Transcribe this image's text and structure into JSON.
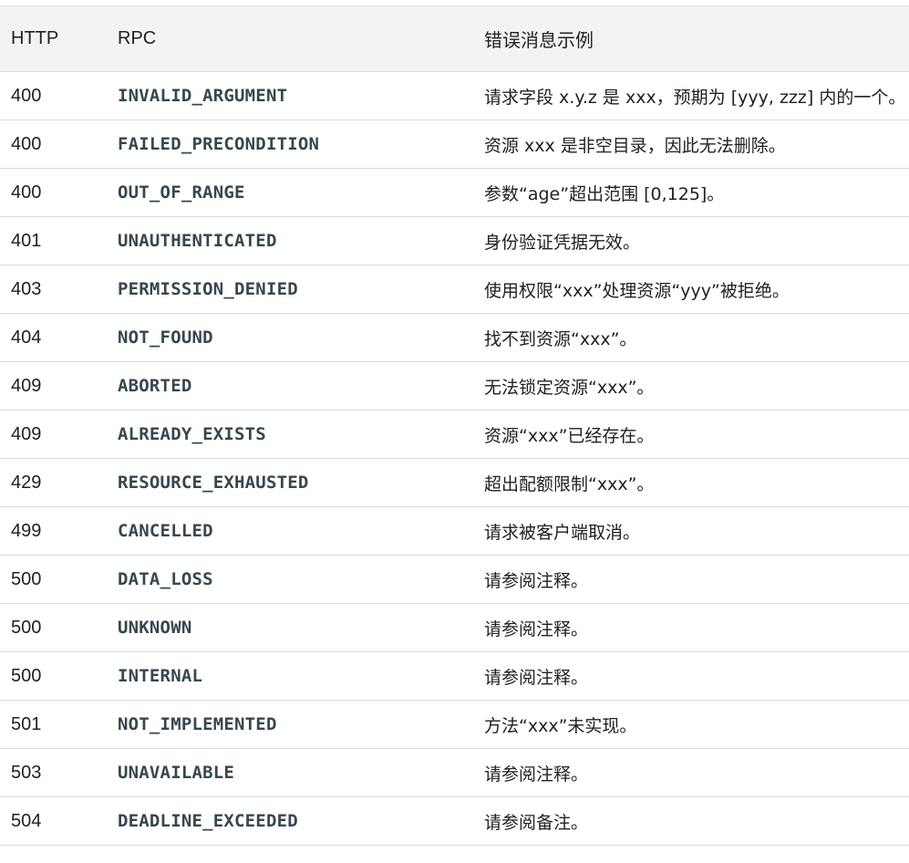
{
  "table": {
    "headers": {
      "http": "HTTP",
      "rpc": "RPC",
      "message": "错误消息示例"
    },
    "rows": [
      {
        "http": "400",
        "rpc": "INVALID_ARGUMENT",
        "message": "请求字段 x.y.z 是 xxx，预期为 [yyy, zzz] 内的一个。"
      },
      {
        "http": "400",
        "rpc": "FAILED_PRECONDITION",
        "message": "资源 xxx 是非空目录，因此无法删除。"
      },
      {
        "http": "400",
        "rpc": "OUT_OF_RANGE",
        "message": "参数“age”超出范围 [0,125]。"
      },
      {
        "http": "401",
        "rpc": "UNAUTHENTICATED",
        "message": "身份验证凭据无效。"
      },
      {
        "http": "403",
        "rpc": "PERMISSION_DENIED",
        "message": "使用权限“xxx”处理资源“yyy”被拒绝。"
      },
      {
        "http": "404",
        "rpc": "NOT_FOUND",
        "message": "找不到资源“xxx”。"
      },
      {
        "http": "409",
        "rpc": "ABORTED",
        "message": "无法锁定资源“xxx”。"
      },
      {
        "http": "409",
        "rpc": "ALREADY_EXISTS",
        "message": "资源“xxx”已经存在。"
      },
      {
        "http": "429",
        "rpc": "RESOURCE_EXHAUSTED",
        "message": "超出配额限制“xxx”。"
      },
      {
        "http": "499",
        "rpc": "CANCELLED",
        "message": "请求被客户端取消。"
      },
      {
        "http": "500",
        "rpc": "DATA_LOSS",
        "message": "请参阅注释。"
      },
      {
        "http": "500",
        "rpc": "UNKNOWN",
        "message": "请参阅注释。"
      },
      {
        "http": "500",
        "rpc": "INTERNAL",
        "message": "请参阅注释。"
      },
      {
        "http": "501",
        "rpc": "NOT_IMPLEMENTED",
        "message": "方法“xxx”未实现。"
      },
      {
        "http": "503",
        "rpc": "UNAVAILABLE",
        "message": "请参阅注释。"
      },
      {
        "http": "504",
        "rpc": "DEADLINE_EXCEEDED",
        "message": "请参阅备注。"
      }
    ]
  },
  "colors": {
    "header_bg": "#f1f3f4",
    "row_border": "#dadce0",
    "text": "#202124",
    "code_text": "#37474f"
  }
}
